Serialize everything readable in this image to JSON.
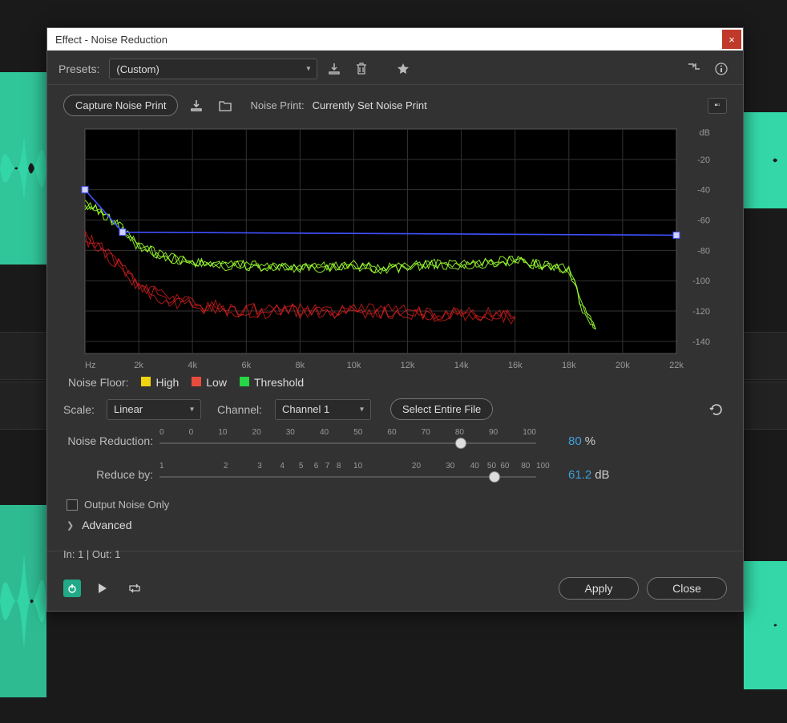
{
  "window": {
    "title": "Effect - Noise Reduction",
    "close": "×"
  },
  "toolbar": {
    "presets_label": "Presets:",
    "preset_value": "(Custom)"
  },
  "noise_print": {
    "capture_label": "Capture Noise Print",
    "label": "Noise Print:",
    "value": "Currently Set Noise Print"
  },
  "legend": {
    "floor_label": "Noise Floor:",
    "high": "High",
    "low": "Low",
    "threshold": "Threshold",
    "colors": {
      "high": "#f1d40f",
      "low": "#e74c3c",
      "threshold": "#27d645"
    }
  },
  "scale": {
    "label": "Scale:",
    "value": "Linear",
    "channel_label": "Channel:",
    "channel_value": "Channel 1",
    "select_file": "Select Entire File"
  },
  "sliders": {
    "nr_label": "Noise Reduction:",
    "nr_ticks": [
      "0",
      "0",
      "10",
      "20",
      "30",
      "40",
      "50",
      "60",
      "70",
      "80",
      "90",
      "100"
    ],
    "nr_value": "80",
    "nr_unit": "%",
    "nr_pos_pct": 80,
    "rb_label": "Reduce by:",
    "rb_ticks": [
      {
        "v": "1",
        "p": 0
      },
      {
        "v": "2",
        "p": 17
      },
      {
        "v": "3",
        "p": 26
      },
      {
        "v": "4",
        "p": 32
      },
      {
        "v": "5",
        "p": 37
      },
      {
        "v": "6",
        "p": 41
      },
      {
        "v": "7",
        "p": 44
      },
      {
        "v": "8",
        "p": 47
      },
      {
        "v": "10",
        "p": 51.5
      },
      {
        "v": "20",
        "p": 67
      },
      {
        "v": "30",
        "p": 76
      },
      {
        "v": "40",
        "p": 82.5
      },
      {
        "v": "50",
        "p": 87
      },
      {
        "v": "60",
        "p": 90.5
      },
      {
        "v": "80",
        "p": 96
      },
      {
        "v": "100",
        "p": 100
      }
    ],
    "rb_value": "61.2",
    "rb_unit": "dB",
    "rb_pos_pct": 89
  },
  "checkbox": {
    "output_noise": "Output Noise Only",
    "advanced": "Advanced"
  },
  "footer": {
    "io": "In: 1 | Out: 1",
    "apply": "Apply",
    "close": "Close"
  },
  "chart_data": {
    "type": "line",
    "xlabel": "Hz",
    "ylabel": "dB",
    "xlim": [
      0,
      22000
    ],
    "ylim": [
      -148,
      0
    ],
    "x_ticks": [
      "Hz",
      "2k",
      "4k",
      "6k",
      "8k",
      "10k",
      "12k",
      "14k",
      "16k",
      "18k",
      "20k",
      "22k"
    ],
    "y_ticks": [
      "dB",
      "-20",
      "-40",
      "-60",
      "-80",
      "-100",
      "-120",
      "-140"
    ],
    "series": [
      {
        "name": "Threshold (control points)",
        "color": "#4050ff",
        "x": [
          0,
          1400,
          22000
        ],
        "values": [
          -40,
          -68,
          -70
        ]
      },
      {
        "name": "High",
        "color": "#9aff2e",
        "x": [
          0,
          500,
          1000,
          1500,
          2000,
          3000,
          4000,
          5000,
          6000,
          7000,
          8000,
          9000,
          10000,
          11000,
          12000,
          13000,
          14000,
          15000,
          16000,
          17000,
          18000,
          18500,
          19000
        ],
        "values": [
          -50,
          -54,
          -60,
          -68,
          -78,
          -84,
          -88,
          -90,
          -90,
          -91,
          -92,
          -91,
          -90,
          -92,
          -91,
          -89,
          -90,
          -88,
          -87,
          -90,
          -92,
          -118,
          -132
        ]
      },
      {
        "name": "Low",
        "color": "#e02020",
        "x": [
          0,
          500,
          1000,
          1500,
          2000,
          3000,
          4000,
          5000,
          6000,
          7000,
          8000,
          9000,
          10000,
          11000,
          12000,
          13000,
          14000,
          15000,
          16000
        ],
        "values": [
          -72,
          -78,
          -86,
          -94,
          -104,
          -112,
          -116,
          -118,
          -120,
          -120,
          -120,
          -121,
          -120,
          -120,
          -121,
          -122,
          -122,
          -122,
          -124
        ]
      }
    ]
  }
}
